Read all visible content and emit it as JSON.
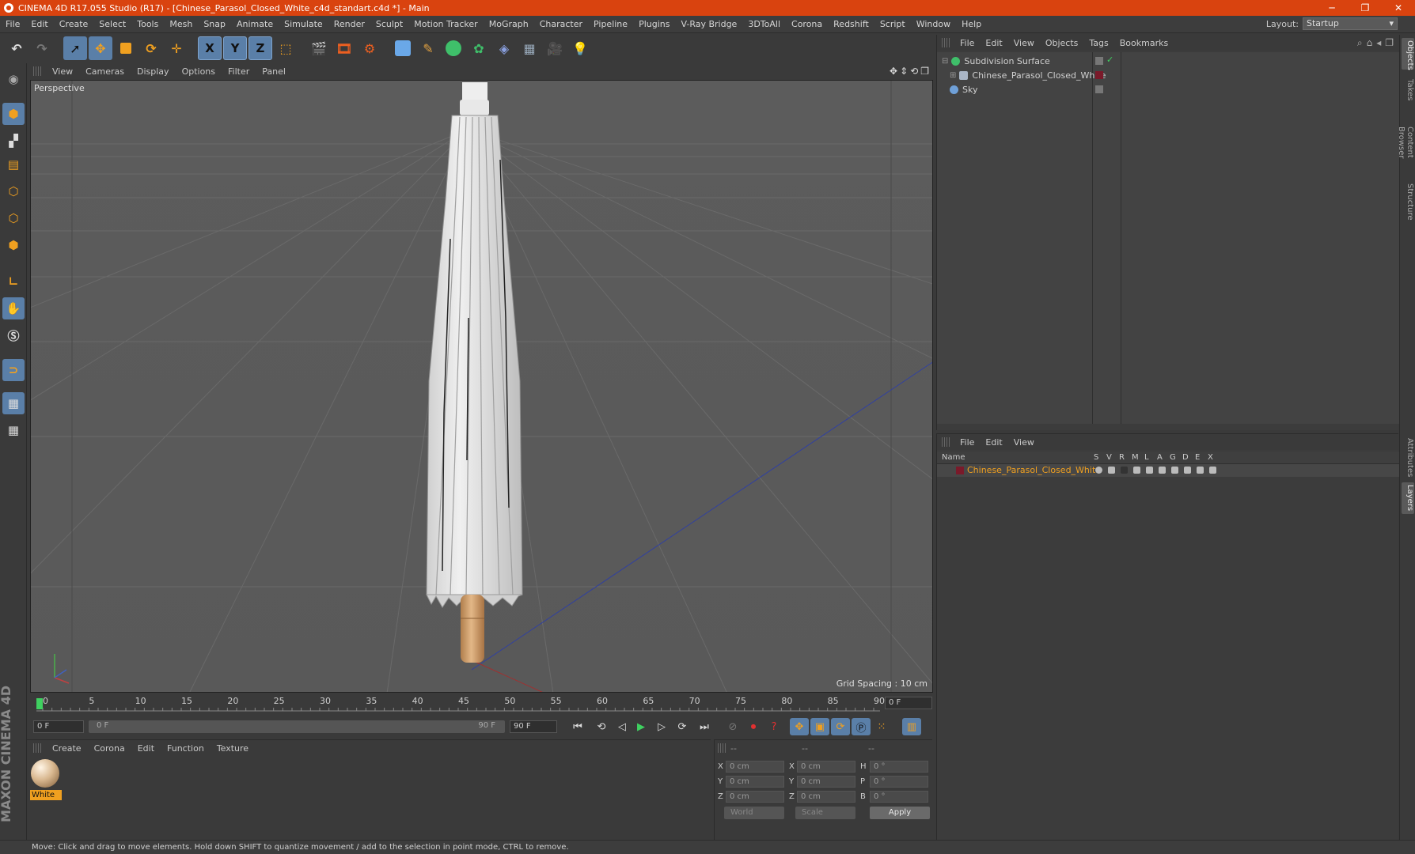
{
  "window": {
    "title": "CINEMA 4D R17.055 Studio (R17) - [Chinese_Parasol_Closed_White_c4d_standart.c4d *] - Main",
    "controls": [
      "─",
      "❐",
      "✕"
    ]
  },
  "menu": [
    "File",
    "Edit",
    "Create",
    "Select",
    "Tools",
    "Mesh",
    "Snap",
    "Animate",
    "Simulate",
    "Render",
    "Sculpt",
    "Motion Tracker",
    "MoGraph",
    "Character",
    "Pipeline",
    "Plugins",
    "V-Ray Bridge",
    "3DToAll",
    "Corona",
    "Redshift",
    "Script",
    "Window",
    "Help"
  ],
  "layout": {
    "label": "Layout:",
    "value": "Startup"
  },
  "toolbar": {
    "icons": [
      "undo-icon",
      "redo-icon",
      "select-icon",
      "move-icon",
      "scale-icon",
      "rotate-icon",
      "live-select-icon",
      "x-axis",
      "y-axis",
      "z-axis",
      "world-coord-icon",
      "render-view-icon",
      "render-picture-viewer-icon",
      "render-settings-icon",
      "cube-icon",
      "pen-icon",
      "subdivision-icon",
      "array-icon",
      "deformer-icon",
      "floor-icon",
      "camera-icon",
      "light-icon"
    ],
    "axis_labels": [
      "X",
      "Y",
      "Z"
    ]
  },
  "viewport": {
    "menu": [
      "View",
      "Cameras",
      "Display",
      "Options",
      "Filter",
      "Panel"
    ],
    "label": "Perspective",
    "grid_spacing": "Grid Spacing : 10 cm"
  },
  "timeline": {
    "ticks": [
      "0",
      "5",
      "10",
      "15",
      "20",
      "25",
      "30",
      "35",
      "40",
      "45",
      "50",
      "55",
      "60",
      "65",
      "70",
      "75",
      "80",
      "85",
      "90"
    ],
    "current_frame": "0 F"
  },
  "transport": {
    "start_field": "0 F",
    "slider_start": "0 F",
    "slider_end": "90 F",
    "end_field": "90 F"
  },
  "material_manager": {
    "menu": [
      "Create",
      "Corona",
      "Edit",
      "Function",
      "Texture"
    ],
    "materials": [
      {
        "name": "White"
      }
    ]
  },
  "coordinates": {
    "headers": [
      "--",
      "--",
      "--"
    ],
    "rows": [
      {
        "axis1": "X",
        "val1": "0 cm",
        "axis2": "X",
        "val2": "0 cm",
        "axis3": "H",
        "val3": "0 °"
      },
      {
        "axis1": "Y",
        "val1": "0 cm",
        "axis2": "Y",
        "val2": "0 cm",
        "axis3": "P",
        "val3": "0 °"
      },
      {
        "axis1": "Z",
        "val1": "0 cm",
        "axis2": "Z",
        "val2": "0 cm",
        "axis3": "B",
        "val3": "0 °"
      }
    ],
    "space": "World",
    "mode": "Scale",
    "apply_label": "Apply"
  },
  "status": "Move: Click and drag to move elements. Hold down SHIFT to quantize movement / add to the selection in point mode, CTRL to remove.",
  "object_manager": {
    "menu": [
      "File",
      "Edit",
      "View",
      "Objects",
      "Tags",
      "Bookmarks"
    ],
    "objects": [
      {
        "name": "Subdivision Surface",
        "icon_color": "#3fbf6a"
      },
      {
        "name": "Chinese_Parasol_Closed_White",
        "icon_color": "#aab6c6"
      },
      {
        "name": "Sky",
        "icon_color": "#6fa0d8"
      }
    ]
  },
  "layer_manager": {
    "menu": [
      "File",
      "Edit",
      "View"
    ],
    "columns": [
      "Name",
      "S",
      "V",
      "R",
      "M",
      "L",
      "A",
      "G",
      "D",
      "E",
      "X"
    ],
    "layers": [
      {
        "name": "Chinese_Parasol_Closed_White",
        "color": "#7a1a2a"
      }
    ]
  },
  "right_tabs": [
    "Objects",
    "Takes",
    "Content Browser",
    "Structure",
    "Attributes",
    "Layers"
  ],
  "maxon_logo": "MAXON CINEMA 4D",
  "colors": {
    "title_bar": "#d9430f",
    "accent_blue": "#5a7fa8",
    "highlight_orange": "#f0a020"
  }
}
